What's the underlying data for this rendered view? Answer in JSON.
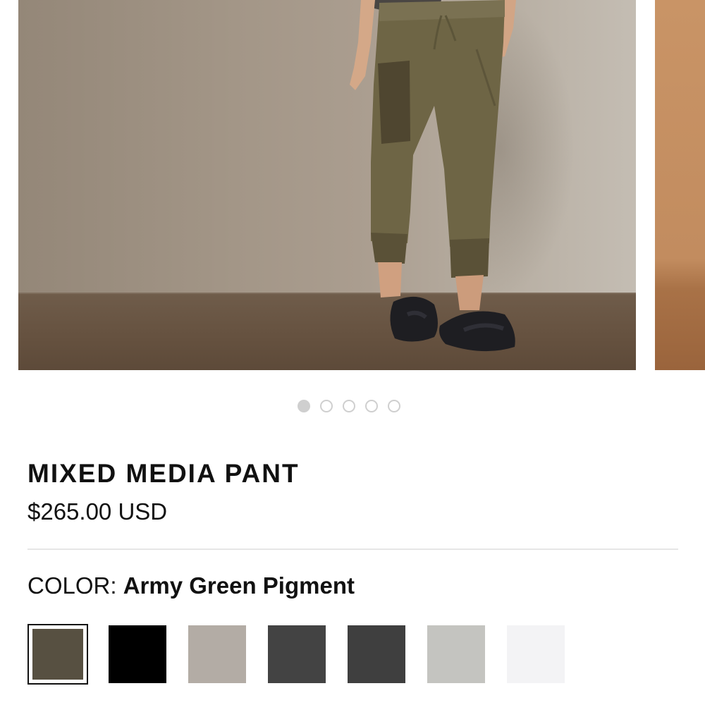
{
  "product": {
    "name": "MIXED MEDIA PANT",
    "price": "$265.00 USD",
    "color_label": "COLOR:",
    "selected_color": "Army Green Pigment"
  },
  "gallery": {
    "slide_count": 5,
    "active_slide": 1
  },
  "swatches": [
    {
      "name": "Army Green Pigment",
      "color": "#575041",
      "selected": true
    },
    {
      "name": "Black",
      "color": "#000000",
      "selected": false
    },
    {
      "name": "Light Taupe",
      "color": "#b3aca5",
      "selected": false
    },
    {
      "name": "Charcoal",
      "color": "#434343",
      "selected": false
    },
    {
      "name": "Dark Grey",
      "color": "#3f3f3f",
      "selected": false
    },
    {
      "name": "Light Grey",
      "color": "#c4c4c0",
      "selected": false
    },
    {
      "name": "White",
      "color": "#f3f3f5",
      "selected": false
    }
  ],
  "colors": {
    "text": "#111111",
    "divider": "#e6e6e6",
    "dot": "#cfcfcf"
  }
}
